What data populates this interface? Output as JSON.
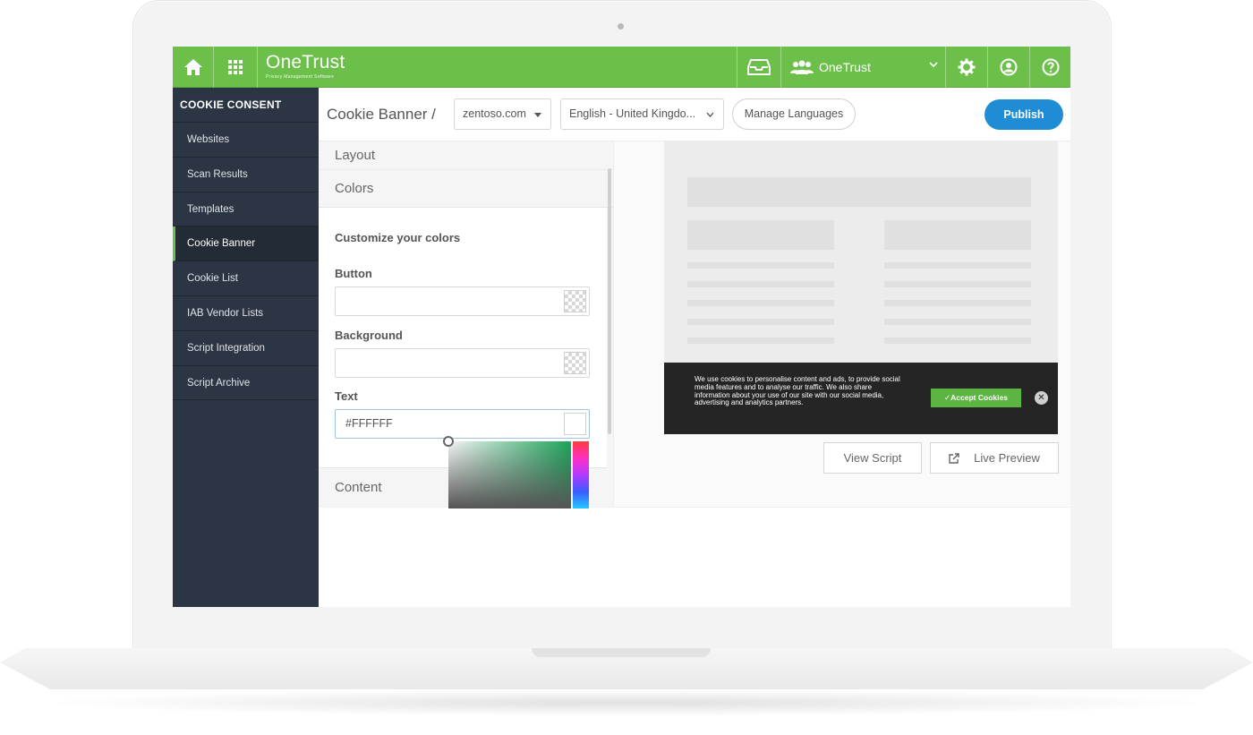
{
  "topbar": {
    "logo": "OneTrust",
    "logo_tagline": "Privacy Management Software",
    "org_name": "OneTrust",
    "colors": {
      "brand_green": "#6cc04a"
    }
  },
  "sidebar": {
    "title": "COOKIE CONSENT",
    "items": [
      {
        "label": "Websites"
      },
      {
        "label": "Scan Results"
      },
      {
        "label": "Templates"
      },
      {
        "label": "Cookie Banner",
        "active": true
      },
      {
        "label": "Cookie List"
      },
      {
        "label": "IAB Vendor Lists"
      },
      {
        "label": "Script Integration"
      },
      {
        "label": "Script Archive"
      }
    ]
  },
  "header": {
    "breadcrumb": "Cookie Banner /",
    "domain_select": "zentoso.com",
    "language_select": "English - United Kingdo...",
    "manage_languages": "Manage Languages",
    "publish": "Publish"
  },
  "panel": {
    "sections": {
      "layout": "Layout",
      "colors": "Colors",
      "content": "Content"
    },
    "customize_heading": "Customize your colors",
    "fields": {
      "button": {
        "label": "Button",
        "value": ""
      },
      "background": {
        "label": "Background",
        "value": ""
      },
      "text": {
        "label": "Text",
        "value": "#FFFFFF"
      }
    }
  },
  "preview": {
    "banner_text": "We use cookies to personalise content and ads, to provide social media features and to analyse our traffic. We also share information about your use of our site with our social media, advertising and analytics partners.",
    "accept_label": "✓Accept Cookies",
    "close_symbol": "✕",
    "view_script": "View Script",
    "live_preview": "Live Preview",
    "colors": {
      "banner_bg": "#252525",
      "accept_bg": "#5cb443"
    }
  },
  "icons": [
    "home-icon",
    "apps-grid-icon",
    "inbox-icon",
    "users-icon",
    "chevron-down-icon",
    "gear-icon",
    "user-icon",
    "help-icon",
    "external-link-icon",
    "close-icon"
  ]
}
